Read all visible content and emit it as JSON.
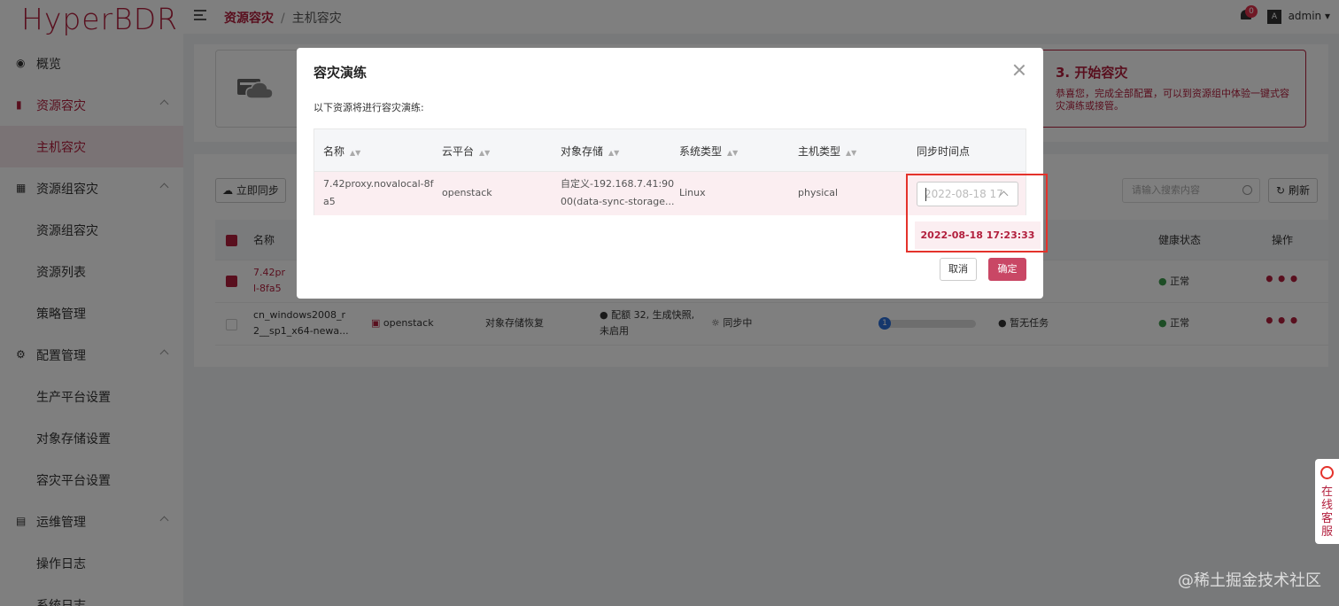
{
  "app": {
    "logo": "HyperBDR"
  },
  "sidebar": {
    "overview": "概览",
    "resource_dr": "资源容灾",
    "host_dr": "主机容灾",
    "group_dr": "资源组容灾",
    "group_dr_sub": "资源组容灾",
    "resource_list": "资源列表",
    "policy": "策略管理",
    "config": "配置管理",
    "prod_platform": "生产平台设置",
    "object_storage": "对象存储设置",
    "dr_platform": "容灾平台设置",
    "ops": "运维管理",
    "op_log": "操作日志",
    "sys_log": "系统日志"
  },
  "topbar": {
    "breadcrumb_1": "资源容灾",
    "breadcrumb_sep": "/",
    "breadcrumb_2": "主机容灾",
    "notif_count": "0",
    "lang": "A",
    "user": "admin ▾"
  },
  "steps": {
    "step3_title": "3. 开始容灾",
    "step3_desc": "恭喜您，完成全部配置，可以到资源组中体验一键式容灾演练或接管。"
  },
  "list": {
    "sync_button": "立即同步",
    "search_placeholder": "请输入搜索内容",
    "refresh_button": "刷新",
    "col_name": "名称",
    "col_health": "健康状态",
    "col_action": "操作",
    "row1": {
      "name_line1": "7.42pr",
      "name_line2": "l-8fa5",
      "health": "正常",
      "action": "•••"
    },
    "row2": {
      "name_line1": "cn_windows2008_r",
      "name_line2": "2__sp1_x64-newa...",
      "cloud": "openstack",
      "recovery": "对象存储恢复",
      "quota": "配额 32, 生成快照,",
      "quota2": "未启用",
      "sync_state": "同步中",
      "progress_badge": "1",
      "task": "暂无任务",
      "health": "正常",
      "action": "•••"
    }
  },
  "modal": {
    "title": "容灾演练",
    "description": "以下资源将进行容灾演练:",
    "headers": [
      "名称",
      "云平台",
      "对象存储",
      "系统类型",
      "主机类型",
      "同步时间点"
    ],
    "row": {
      "name_line1": "7.42proxy.novalocal-8f",
      "name_line2": "a5",
      "cloud": "openstack",
      "storage_line1": "自定义-192.168.7.41:90",
      "storage_line2": "00(data-sync-storage...",
      "os": "Linux",
      "host_type": "physical",
      "sync_point_placeholder": "2022-08-18 17"
    },
    "dropdown_option": "2022-08-18 17:23:33",
    "cancel": "取消",
    "confirm": "确定"
  },
  "service": {
    "label": "在线客服"
  },
  "watermark": "@稀土掘金技术社区"
}
